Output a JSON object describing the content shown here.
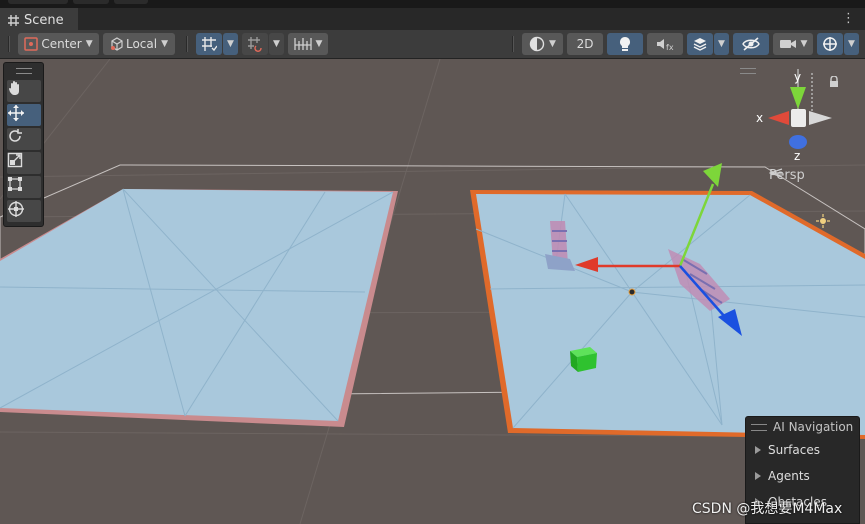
{
  "window": {
    "tab_title": "Scene",
    "tab_icon": "grid-icon",
    "menu_icon": "kebab-menu-icon"
  },
  "toolbar": {
    "pivot_mode": "Center",
    "pivot_rotation": "Local",
    "mode_2d_label": "2D",
    "icons": [
      "grid-snap-icon",
      "increment-snap-icon",
      "draw-mode-icon",
      "lighting-icon",
      "audio-mute-icon",
      "fx-layers-icon",
      "visibility-icon",
      "camera-icon",
      "gizmos-icon"
    ]
  },
  "scene_view": {
    "projection_label": "Persp",
    "gizmo_axes": {
      "x": "x",
      "y": "y",
      "z": "z"
    }
  },
  "tools": [
    "hand-tool",
    "move-tool",
    "rotate-tool",
    "scale-tool",
    "rect-tool",
    "transform-tool"
  ],
  "ai_navigation": {
    "title": "AI Navigation",
    "items": [
      {
        "label": "Surfaces"
      },
      {
        "label": "Agents"
      },
      {
        "label": "Obstacles"
      }
    ]
  },
  "watermark": "CSDN @我想要M4Max",
  "colors": {
    "accent_active": "#46607c",
    "navmesh": "#a9c8dc",
    "selection_outline": "#e06a2a",
    "axis_x": "#e03a2a",
    "axis_y": "#7dd63a",
    "axis_z": "#1a50e0"
  }
}
